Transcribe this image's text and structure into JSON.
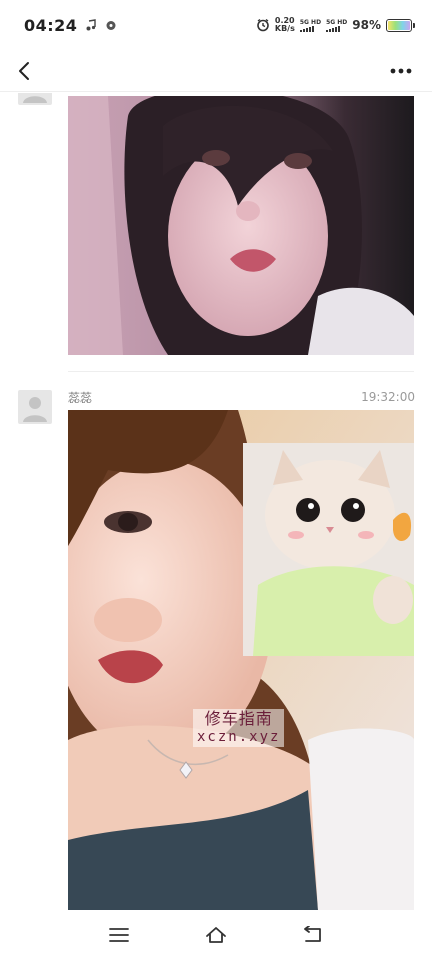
{
  "status_bar": {
    "time": "04:24",
    "net_speed_value": "0.20",
    "net_speed_unit": "KB/s",
    "sim1_label": "5G HD",
    "sim2_label": "5G HD",
    "battery_percent": "98%",
    "battery_level": 0.98
  },
  "header": {
    "back_icon": "chevron-left-icon",
    "more_icon": "more-dots-icon"
  },
  "posts": [
    {
      "avatar_icon": "default-avatar-icon",
      "image_description_kind": "selfie-photo"
    },
    {
      "avatar_icon": "default-avatar-icon",
      "username": "蕊蕊",
      "time": "19:32:00",
      "watermark_line1": "修车指南",
      "watermark_line2": "xczn.xyz"
    }
  ],
  "bottom_nav": {
    "menu_icon": "menu-icon",
    "home_icon": "home-icon",
    "back_icon": "return-icon"
  },
  "colors": {
    "divider": "#eeeeee",
    "avatar_bg": "#e6e6e6",
    "watermark_text": "#6b1e3a"
  }
}
